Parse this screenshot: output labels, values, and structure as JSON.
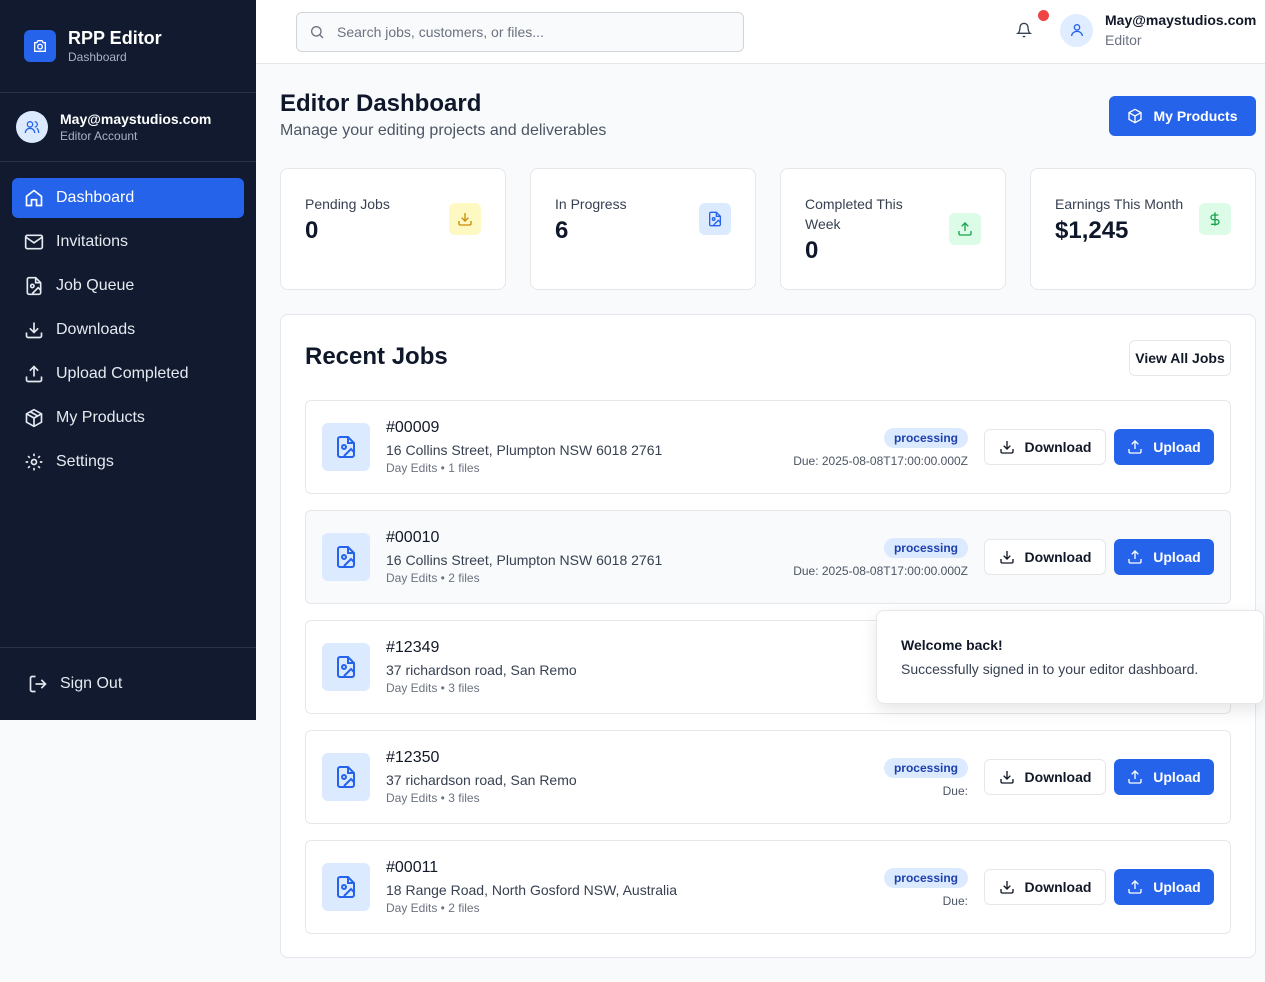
{
  "brand": {
    "title": "RPP Editor",
    "subtitle": "Dashboard"
  },
  "sidebar_user": {
    "email": "May@maystudios.com",
    "role": "Editor Account"
  },
  "nav": [
    {
      "label": "Dashboard",
      "icon": "home-icon",
      "active": true
    },
    {
      "label": "Invitations",
      "icon": "mail-icon"
    },
    {
      "label": "Job Queue",
      "icon": "file-image-icon"
    },
    {
      "label": "Downloads",
      "icon": "download-icon"
    },
    {
      "label": "Upload Completed",
      "icon": "upload-icon"
    },
    {
      "label": "My Products",
      "icon": "package-icon"
    },
    {
      "label": "Settings",
      "icon": "gear-icon"
    }
  ],
  "signout_label": "Sign Out",
  "search": {
    "placeholder": "Search jobs, customers, or files..."
  },
  "top_user": {
    "email": "May@maystudios.com",
    "role": "Editor"
  },
  "page": {
    "title": "Editor Dashboard",
    "subtitle": "Manage your editing projects and deliverables",
    "products_button": "My Products"
  },
  "stats": [
    {
      "label": "Pending Jobs",
      "value": "0",
      "icon": "download-icon",
      "color": "#ca8a04"
    },
    {
      "label": "In Progress",
      "value": "6",
      "icon": "file-image-icon",
      "color": "#2563eb"
    },
    {
      "label": "Completed This Week",
      "value": "0",
      "icon": "upload-icon",
      "color": "#16a34a"
    },
    {
      "label": "Earnings This Month",
      "value": "$1,245",
      "icon": "dollar-icon",
      "color": "#16a34a"
    }
  ],
  "recent": {
    "title": "Recent Jobs",
    "view_all": "View All Jobs",
    "download_label": "Download",
    "upload_label": "Upload",
    "jobs": [
      {
        "id": "#00009",
        "address": "16 Collins Street, Plumpton NSW 6018 2761",
        "meta": "Day Edits • 1 files",
        "status": "processing",
        "due": "Due: 2025-08-08T17:00:00.000Z"
      },
      {
        "id": "#00010",
        "address": "16 Collins Street, Plumpton NSW 6018 2761",
        "meta": "Day Edits • 2 files",
        "status": "processing",
        "due": "Due: 2025-08-08T17:00:00.000Z"
      },
      {
        "id": "#12349",
        "address": "37 richardson road, San Remo",
        "meta": "Day Edits • 3 files",
        "status": "",
        "due": ""
      },
      {
        "id": "#12350",
        "address": "37 richardson road, San Remo",
        "meta": "Day Edits • 3 files",
        "status": "processing",
        "due": "Due:"
      },
      {
        "id": "#00011",
        "address": "18 Range Road, North Gosford NSW, Australia",
        "meta": "Day Edits • 2 files",
        "status": "processing",
        "due": "Due:"
      }
    ]
  },
  "toast": {
    "title": "Welcome back!",
    "message": "Successfully signed in to your editor dashboard."
  }
}
